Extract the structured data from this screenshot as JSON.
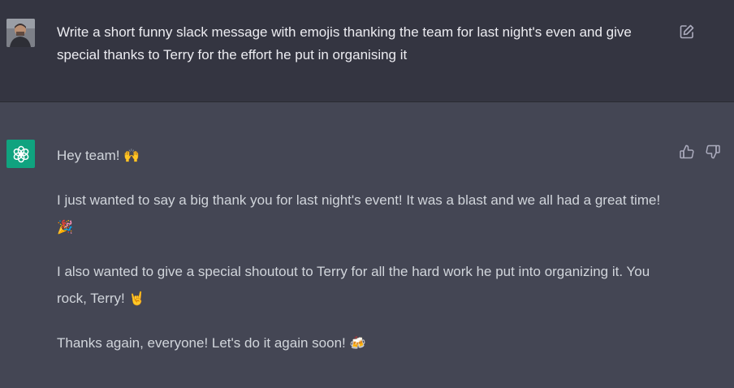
{
  "user_message": {
    "text": "Write a short funny slack message with emojis thanking the team for last night's even and give special thanks to Terry for the effort he put in organising it"
  },
  "assistant_message": {
    "paragraphs": [
      {
        "text": "Hey team! ",
        "emoji": "🙌"
      },
      {
        "text": "I just wanted to say a big thank you for last night's event! It was a blast and we all had a great time! ",
        "emoji": "🎉"
      },
      {
        "text": "I also wanted to give a special shoutout to Terry for all the hard work he put into organizing it. You rock, Terry! ",
        "emoji": "🤘"
      },
      {
        "text": "Thanks again, everyone! Let's do it again soon! ",
        "emoji": "🍻"
      }
    ]
  },
  "icons": {
    "user_avatar": "user-avatar-photo",
    "bot_avatar": "openai-logo-icon",
    "edit": "edit-icon",
    "thumbs_up": "thumbs-up-icon",
    "thumbs_down": "thumbs-down-icon"
  },
  "colors": {
    "user_bg": "#343541",
    "assistant_bg": "#444654",
    "bot_avatar_bg": "#10a37f",
    "user_text": "#ececf1",
    "assistant_text": "#d1d5db"
  }
}
